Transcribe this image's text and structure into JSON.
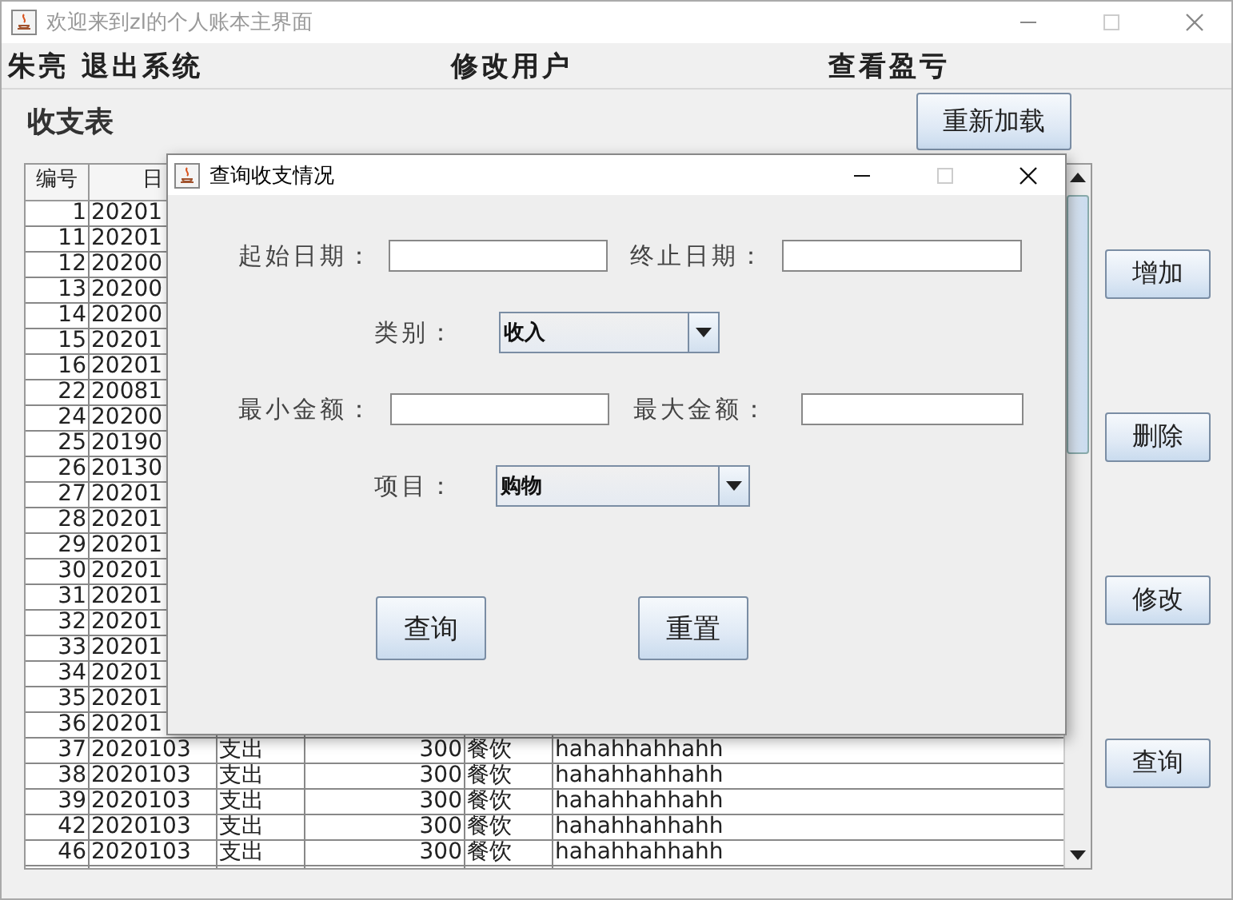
{
  "window": {
    "title": "欢迎来到zl的个人账本主界面"
  },
  "menu": [
    {
      "label": "朱亮"
    },
    {
      "label": "退出系统"
    },
    {
      "label": "修改用户"
    },
    {
      "label": "查看盈亏"
    }
  ],
  "heading": "收支表",
  "reload_button": "重新加载",
  "table": {
    "columns": [
      "编号",
      "日"
    ],
    "rows": [
      {
        "id": "1",
        "date": "20201"
      },
      {
        "id": "11",
        "date": "20201"
      },
      {
        "id": "12",
        "date": "20200"
      },
      {
        "id": "13",
        "date": "20200"
      },
      {
        "id": "14",
        "date": "20200"
      },
      {
        "id": "15",
        "date": "20201"
      },
      {
        "id": "16",
        "date": "20201"
      },
      {
        "id": "22",
        "date": "20081"
      },
      {
        "id": "24",
        "date": "20200"
      },
      {
        "id": "25",
        "date": "20190"
      },
      {
        "id": "26",
        "date": "20130"
      },
      {
        "id": "27",
        "date": "20201"
      },
      {
        "id": "28",
        "date": "20201"
      },
      {
        "id": "29",
        "date": "20201"
      },
      {
        "id": "30",
        "date": "20201"
      },
      {
        "id": "31",
        "date": "20201"
      },
      {
        "id": "32",
        "date": "20201"
      },
      {
        "id": "33",
        "date": "20201"
      },
      {
        "id": "34",
        "date": "20201"
      },
      {
        "id": "35",
        "date": "20201"
      },
      {
        "id": "36",
        "date": "20201"
      },
      {
        "id": "37",
        "date": "2020103",
        "type": "支出",
        "amount": "300",
        "item": "餐饮",
        "note": "hahahhahhahh"
      },
      {
        "id": "38",
        "date": "2020103",
        "type": "支出",
        "amount": "300",
        "item": "餐饮",
        "note": "hahahhahhahh"
      },
      {
        "id": "39",
        "date": "2020103",
        "type": "支出",
        "amount": "300",
        "item": "餐饮",
        "note": "hahahhahhahh"
      },
      {
        "id": "42",
        "date": "2020103",
        "type": "支出",
        "amount": "300",
        "item": "餐饮",
        "note": "hahahhahhahh"
      },
      {
        "id": "46",
        "date": "2020103",
        "type": "支出",
        "amount": "300",
        "item": "餐饮",
        "note": "hahahhahhahh"
      }
    ]
  },
  "side_buttons": [
    "增加",
    "删除",
    "修改",
    "查询"
  ],
  "dialog": {
    "title": "查询收支情况",
    "start_date": {
      "label": "起始日期："
    },
    "end_date": {
      "label": "终止日期："
    },
    "category": {
      "label": "类别：",
      "value": "收入"
    },
    "min_amount": {
      "label": "最小金额："
    },
    "max_amount": {
      "label": "最大金额："
    },
    "project": {
      "label": "项目：",
      "value": "购物"
    },
    "buttons": [
      "查询",
      "重置"
    ]
  }
}
